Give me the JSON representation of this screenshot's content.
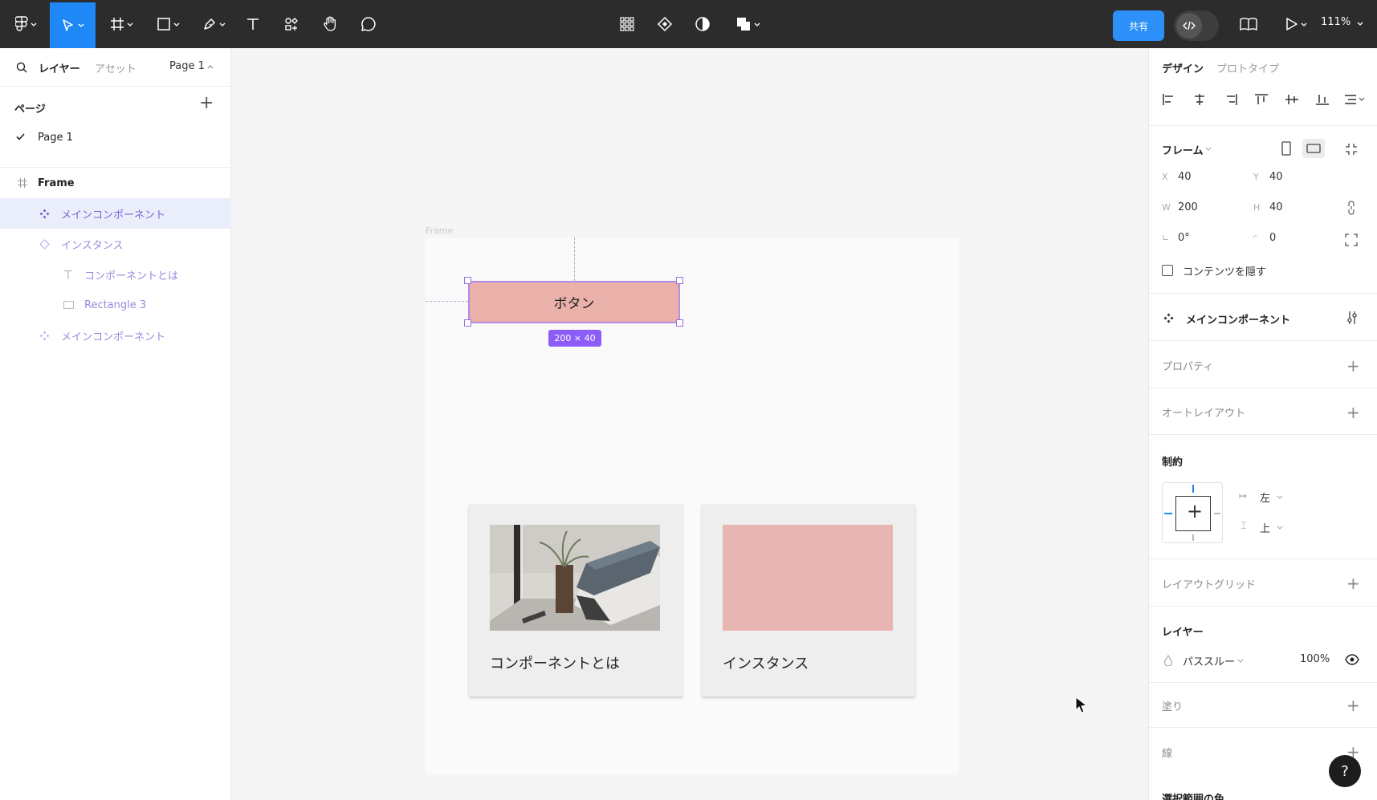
{
  "toolbar": {
    "tools": [
      "main-menu",
      "move",
      "frame",
      "shape",
      "pen",
      "text",
      "resources",
      "hand",
      "comment"
    ],
    "center_tools": [
      "grid",
      "component",
      "mask",
      "boolean"
    ],
    "share_label": "共有",
    "zoom": "111%",
    "accent": "#1e88f7"
  },
  "left_panel": {
    "tabs": {
      "layers": "レイヤー",
      "assets": "アセット",
      "page_selector": "Page 1"
    },
    "pages_title": "ページ",
    "pages": [
      {
        "label": "Page 1",
        "selected": true
      }
    ],
    "layers": [
      {
        "label": "Frame",
        "icon": "frame-icon",
        "depth": 0
      },
      {
        "label": "メインコンポーネント",
        "icon": "component-icon",
        "depth": 1,
        "selected": true
      },
      {
        "label": "インスタンス",
        "icon": "instance-icon",
        "depth": 1
      },
      {
        "label": "コンポーネントとは",
        "icon": "text-icon",
        "depth": 2
      },
      {
        "label": "Rectangle 3",
        "icon": "rectangle-icon",
        "depth": 2
      },
      {
        "label": "メインコンポーネント",
        "icon": "component-icon",
        "depth": 1
      }
    ]
  },
  "canvas": {
    "frame_label": "Frame",
    "button_label": "ボタン",
    "size_badge": "200 × 40",
    "cards": [
      {
        "caption": "コンポーネントとは",
        "media": "photo-of-books-and-plant"
      },
      {
        "caption": "インスタンス",
        "media": "pink-rectangle"
      }
    ],
    "button_color": "#e9b1aa",
    "selection_color": "#8b5cf6"
  },
  "right_panel": {
    "tabs": {
      "design": "デザイン",
      "prototype": "プロトタイプ"
    },
    "frame_title": "フレーム",
    "x": "40",
    "y": "40",
    "w": "200",
    "h": "40",
    "rotation": "0°",
    "radius": "0",
    "clip_content": "コンテンツを隠す",
    "component_title": "メインコンポーネント",
    "properties": "プロパティ",
    "auto_layout": "オートレイアウト",
    "constraints": "制約",
    "constraint_h": "左",
    "constraint_v": "上",
    "layout_grid": "レイアウトグリッド",
    "layer_title": "レイヤー",
    "blend": "パススルー",
    "opacity": "100%",
    "fill": "塗り",
    "stroke": "線",
    "selection_colors": "選択範囲の色"
  },
  "help": "?"
}
